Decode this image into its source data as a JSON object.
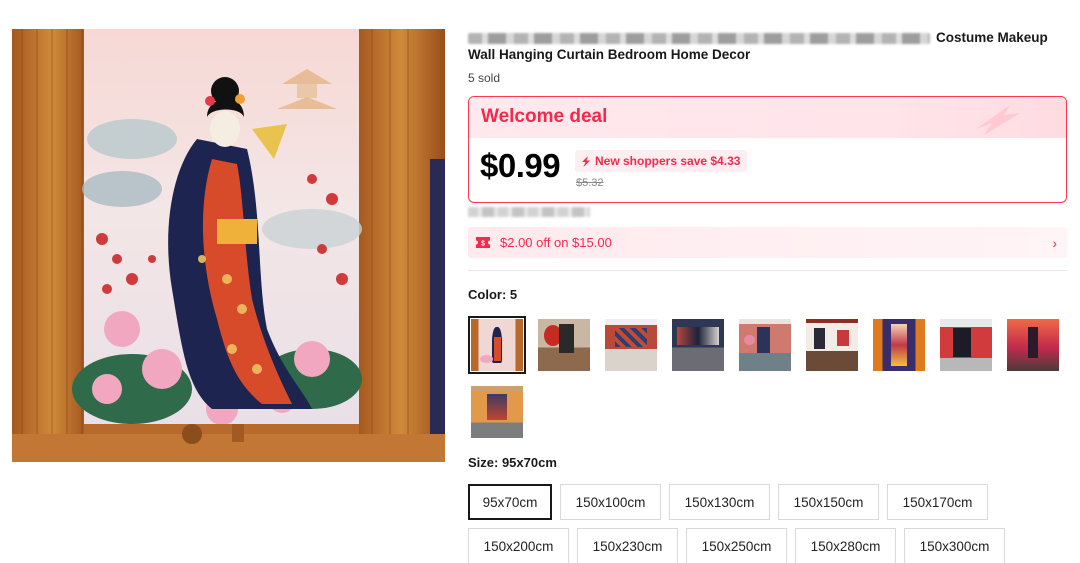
{
  "product": {
    "title_visible": "Costume Makeup",
    "title_line2": "Wall Hanging Curtain Bedroom Home Decor",
    "sold": "5 sold"
  },
  "deal": {
    "title": "Welcome deal",
    "price": "$0.99",
    "save_text": "New shoppers save $4.33",
    "old_price": "$5.32"
  },
  "coupon": {
    "text": "$2.00 off on $15.00",
    "chevron": "›"
  },
  "color": {
    "label": "Color: 5",
    "options": [
      {
        "name": "geisha-pink-peony",
        "selected": true
      },
      {
        "name": "red-sun-room"
      },
      {
        "name": "geisha-pattern-room"
      },
      {
        "name": "dark-wave-room"
      },
      {
        "name": "geisha-flowers-room"
      },
      {
        "name": "geisha-white-room"
      },
      {
        "name": "purple-geisha"
      },
      {
        "name": "red-black-geisha"
      },
      {
        "name": "sunset-geisha"
      },
      {
        "name": "orange-geisha-room"
      }
    ]
  },
  "size": {
    "label": "Size: 95x70cm",
    "options": [
      {
        "label": "95x70cm",
        "selected": true
      },
      {
        "label": "150x100cm"
      },
      {
        "label": "150x130cm"
      },
      {
        "label": "150x150cm"
      },
      {
        "label": "150x170cm"
      },
      {
        "label": "150x200cm"
      },
      {
        "label": "150x230cm"
      },
      {
        "label": "150x250cm"
      },
      {
        "label": "150x280cm"
      },
      {
        "label": "150x300cm"
      }
    ]
  },
  "colors": {
    "accent": "#f5294c",
    "border_accent": "#fd384f",
    "selected_border": "#191919"
  },
  "icons": {
    "save_tag": "lightning-icon",
    "coupon": "ticket-icon",
    "deal_decoration": "arrow-icon"
  }
}
